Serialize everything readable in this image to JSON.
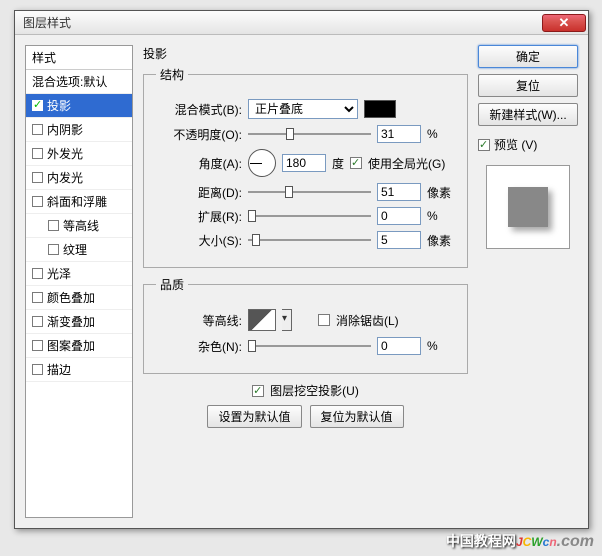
{
  "window": {
    "title": "图层样式"
  },
  "styles": {
    "header": "样式",
    "blending": "混合选项:默认",
    "items": [
      {
        "label": "投影",
        "checked": true,
        "selected": true
      },
      {
        "label": "内阴影",
        "checked": false
      },
      {
        "label": "外发光",
        "checked": false
      },
      {
        "label": "内发光",
        "checked": false
      },
      {
        "label": "斜面和浮雕",
        "checked": false
      },
      {
        "label": "等高线",
        "checked": false,
        "indent": true
      },
      {
        "label": "纹理",
        "checked": false,
        "indent": true
      },
      {
        "label": "光泽",
        "checked": false
      },
      {
        "label": "颜色叠加",
        "checked": false
      },
      {
        "label": "渐变叠加",
        "checked": false
      },
      {
        "label": "图案叠加",
        "checked": false
      },
      {
        "label": "描边",
        "checked": false
      }
    ]
  },
  "panel": {
    "title": "投影",
    "structure": {
      "legend": "结构",
      "blend_mode_label": "混合模式(B):",
      "blend_mode_value": "正片叠底",
      "opacity_label": "不透明度(O):",
      "opacity_value": "31",
      "opacity_unit": "%",
      "angle_label": "角度(A):",
      "angle_value": "180",
      "angle_unit": "度",
      "global_light_label": "使用全局光(G)",
      "distance_label": "距离(D):",
      "distance_value": "51",
      "distance_unit": "像素",
      "spread_label": "扩展(R):",
      "spread_value": "0",
      "spread_unit": "%",
      "size_label": "大小(S):",
      "size_value": "5",
      "size_unit": "像素"
    },
    "quality": {
      "legend": "品质",
      "contour_label": "等高线:",
      "anti_alias_label": "消除锯齿(L)",
      "noise_label": "杂色(N):",
      "noise_value": "0",
      "noise_unit": "%"
    },
    "knockout_label": "图层挖空投影(U)",
    "defaults": {
      "make": "设置为默认值",
      "reset": "复位为默认值"
    }
  },
  "right": {
    "ok": "确定",
    "cancel": "复位",
    "new_style": "新建样式(W)...",
    "preview_label": "预览 (V)"
  },
  "watermark": {
    "cn": "中国教程网"
  }
}
